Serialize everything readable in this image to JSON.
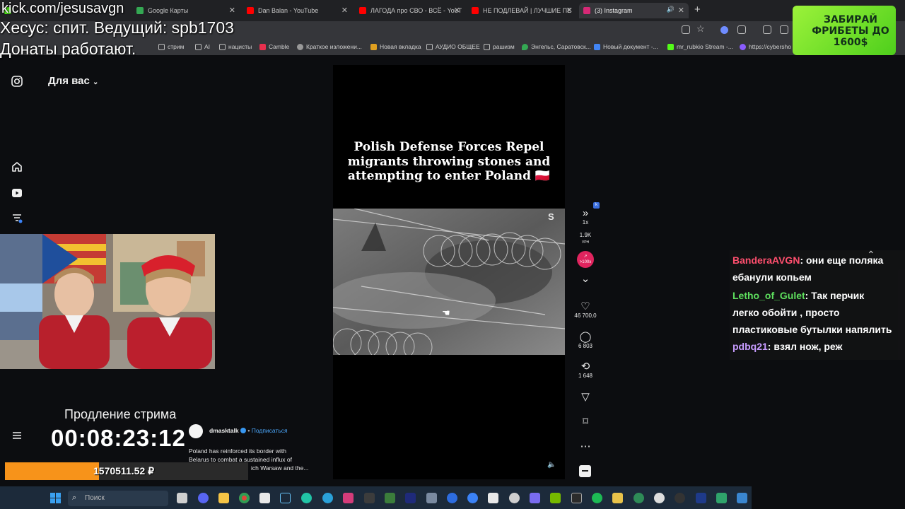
{
  "overlay": {
    "kick_url": "kick.com/jesusavgn",
    "line1": "Хесус: спит. Ведущий: spb1703",
    "line2": "Донаты работают.",
    "promo": "ЗАБИРАЙ ФРИБЕТЫ ДО 1600$",
    "timer_label": "Продление стрима",
    "timer": "00:08:23:12",
    "donation_total": "1570511.52 ₽"
  },
  "tabs": [
    {
      "label": "Google Карты",
      "color": "#34a853"
    },
    {
      "label": "Dan Balan - YouTube",
      "color": "#ff0000"
    },
    {
      "label": "ЛАГОДА про СВО - ВСЁ - YouT",
      "color": "#ff0000"
    },
    {
      "label": "НЕ ПОДЛЕВАЙ | ЛУЧШИЕ ПЕ",
      "color": "#ff0000"
    },
    {
      "label": "(3) Instagram",
      "color": "#d62976"
    }
  ],
  "bookmarks": [
    "стрим",
    "AI",
    "нацисты",
    "Camble",
    "Краткое изложени...",
    "Новая вкладка",
    "АУДИО ОБЩЕЕ",
    "рашизм",
    "Энгельс, Саратовск...",
    "Новый документ -...",
    "mr_rubkio Stream -...",
    "https://cybersho"
  ],
  "instagram": {
    "feed_label": "Для вас",
    "video_title": "Polish Defense Forces Repel migrants throwing stones and attempting to enter Poland 🇵🇱",
    "speed": "1x",
    "vph": "1.9K",
    "vph_unit": "VPH",
    "boost": ">100x",
    "likes": "46 700,0",
    "comments": "6 803",
    "reposts": "1 648",
    "author": "dmasktalk",
    "follow": "Подписаться",
    "caption_line1": "Poland has reinforced its border with",
    "caption_line2": "Belarus to combat a sustained influx of",
    "caption_line3": "ich Warsaw and the..."
  },
  "chat": [
    {
      "user": "BanderaAVGN",
      "text": ": они еще поляка",
      "color": "#ff4f6e"
    },
    {
      "user": "",
      "text": "ебанули копьем",
      "color": "#ffffff"
    },
    {
      "user": "Letho_of_Gulet",
      "text": ": Так перчик",
      "color": "#5ee05e"
    },
    {
      "user": "",
      "text": "легко обойти , просто",
      "color": "#ffffff"
    },
    {
      "user": "",
      "text": "пластиковые бутылки напялить",
      "color": "#ffffff"
    },
    {
      "user": "pdbq21",
      "text": ": взял нож, реж",
      "color": "#c79cff"
    }
  ],
  "taskbar": {
    "search_placeholder": "Поиск"
  }
}
